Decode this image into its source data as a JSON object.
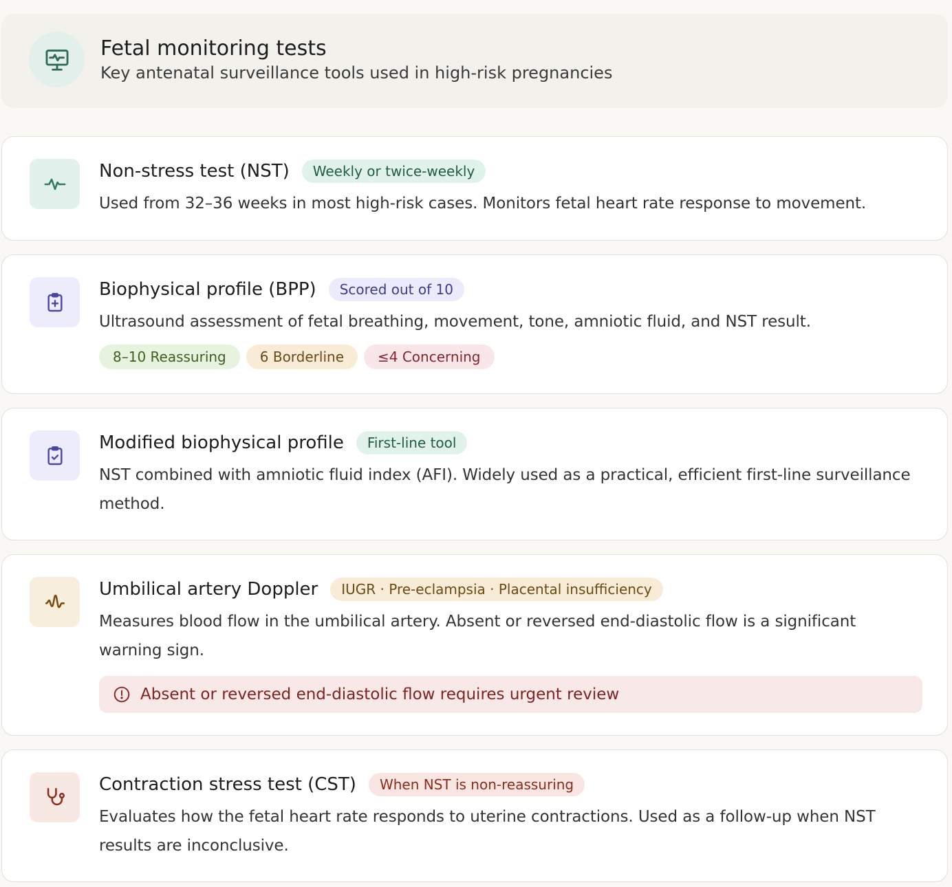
{
  "header": {
    "icon": "monitor-heart-icon",
    "title": "Fetal monitoring tests",
    "subtitle": "Key antenatal surveillance tools used in high-risk pregnancies"
  },
  "colors": {
    "green": "#215c46",
    "purple": "#3d3a8f",
    "amber": "#6a4a14",
    "red": "#8a2c1c"
  },
  "tests": [
    {
      "icon": "activity-pulse-icon",
      "title": "Non-stress test (NST)",
      "tag": "Weekly or twice-weekly",
      "description": "Used from 32–36 weeks in most high-risk cases. Monitors fetal heart rate response to movement."
    },
    {
      "icon": "clipboard-plus-icon",
      "title": "Biophysical profile (BPP)",
      "tag": "Scored out of 10",
      "description": "Ultrasound assessment of fetal breathing, movement, tone, amniotic fluid, and NST result.",
      "scores": [
        "8–10 Reassuring",
        "6 Borderline",
        "≤4 Concerning"
      ]
    },
    {
      "icon": "clipboard-check-icon",
      "title": "Modified biophysical profile",
      "tag": "First-line tool",
      "description": "NST combined with amniotic fluid index (AFI). Widely used as a practical, efficient first-line surveillance method."
    },
    {
      "icon": "waveform-icon",
      "title": "Umbilical artery Doppler",
      "tag": "IUGR · Pre-eclampsia · Placental insufficiency",
      "description": "Measures blood flow in the umbilical artery. Absent or reversed end-diastolic flow is a significant warning sign.",
      "alert": "Absent or reversed end-diastolic flow requires urgent review"
    },
    {
      "icon": "stethoscope-icon",
      "title": "Contraction stress test (CST)",
      "tag": "When NST is non-reassuring",
      "description": "Evaluates how the fetal heart rate responds to uterine contractions. Used as a follow-up when NST results are inconclusive."
    }
  ]
}
